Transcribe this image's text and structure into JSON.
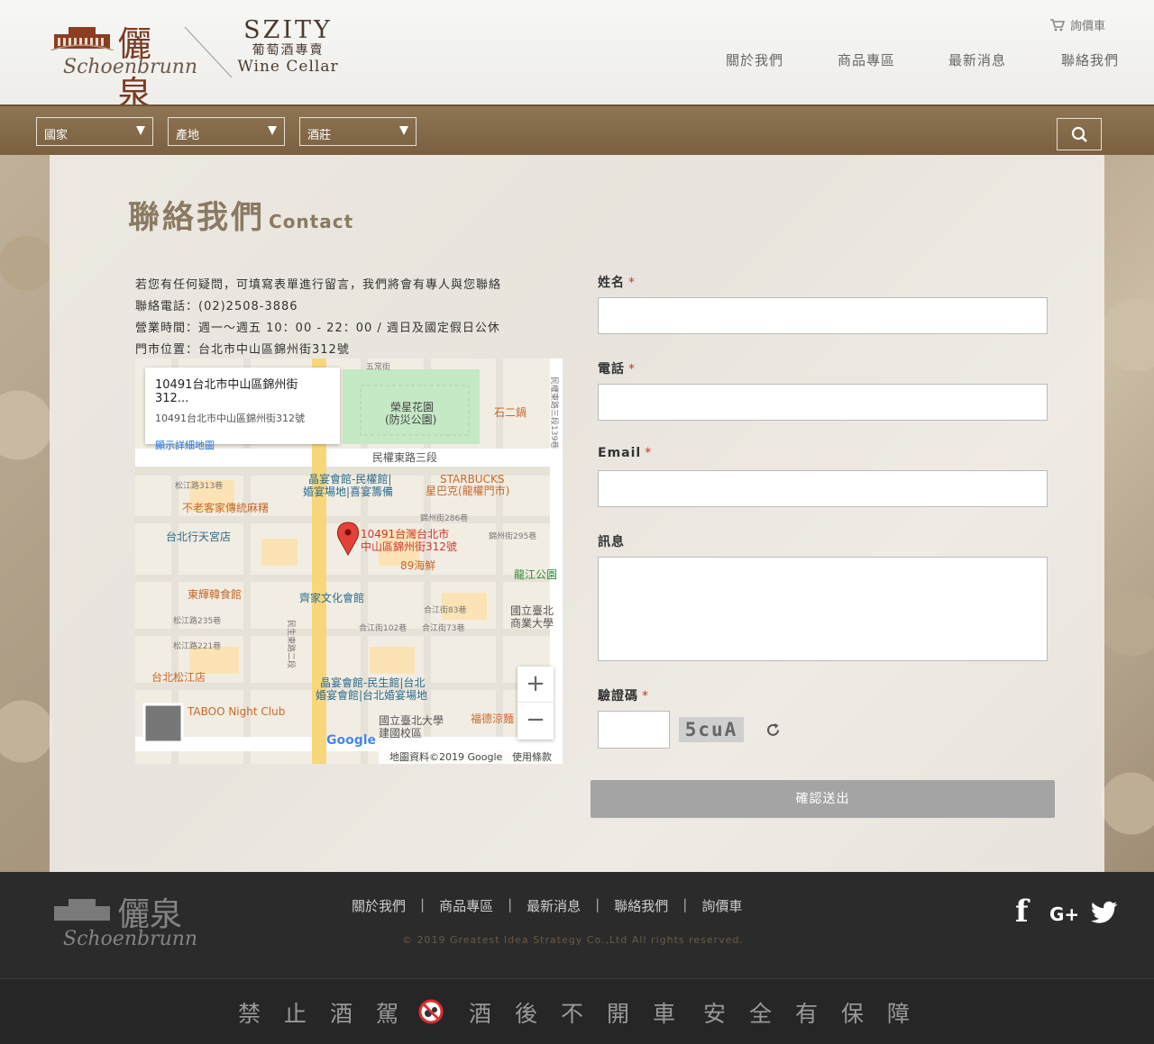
{
  "brand": {
    "logo_cn": "儷泉",
    "logo_en": "Schoenbrunn",
    "szity": "SZITY",
    "szity_cn": "葡萄酒專賣",
    "szity_en": "Wine Cellar"
  },
  "header": {
    "cart_label": "詢價車",
    "nav": [
      "關於我們",
      "商品專區",
      "最新消息",
      "聯絡我們"
    ]
  },
  "filters": {
    "country": "國家",
    "region": "產地",
    "winery": "酒莊"
  },
  "page": {
    "title": "聯絡我們",
    "title_en": "Contact"
  },
  "info": {
    "line1": "若您有任何疑問，可填寫表單進行留言，我們將會有專人與您聯絡",
    "line2": "聯絡電話：(02)2508-3886",
    "line3": "營業時間：週一～週五 10：00 - 22：00 / 週日及國定假日公休",
    "line4": "門市位置：台北市中山區錦州街312號"
  },
  "map": {
    "card_title": "10491台北市中山區錦州街312...",
    "card_sub": "10491台北市中山區錦州街312號",
    "card_link": "顯示詳細地圖",
    "pin_label1": "10491台灣台北市",
    "pin_label2": "中山區錦州街312號",
    "zoom_in": "+",
    "zoom_out": "−",
    "attribution": "地圖資料©2019 Google",
    "terms": "使用條款",
    "google": "Google",
    "places": [
      "榮星花園",
      "(防災公園)",
      "民權東路三段",
      "石二鍋",
      "晶宴會館-民權館|",
      "婚宴場地|喜宴籌備",
      "STARBUCKS",
      "星巴克(龍權門市)",
      "不老客家傳統麻糬",
      "台北行天宮店",
      "89海鮮",
      "東輝韓食館",
      "齊家文化會館",
      "龍江公園",
      "國立臺北",
      "商業大學",
      "建國校區",
      "TABOO Night Club",
      "晶宴會館-民生館|台北",
      "婚宴會館|台北婚宴場地",
      "國立臺北大學",
      "台北松江店",
      "福德涼麵",
      "松江路313巷",
      "錦州街286巷",
      "錦州街295巷",
      "合江街83巷",
      "合江街73巷",
      "合江街102巷",
      "松江路235巷",
      "松江路221巷",
      "五常街",
      "民生東路二段",
      "民權東路三段139巷"
    ]
  },
  "form": {
    "name_label": "姓名",
    "phone_label": "電話",
    "email_label": "Email",
    "message_label": "訊息",
    "captcha_label": "驗證碼",
    "captcha_code": "5cuA",
    "required": "*",
    "submit": "確認送出"
  },
  "footer": {
    "links": [
      "關於我們",
      "商品專區",
      "最新消息",
      "聯絡我們",
      "詢價車"
    ],
    "separator": "|",
    "copyright": "© 2019 Greatest Idea Strategy Co.,Ltd All rights reserved.",
    "social": [
      "facebook-icon",
      "google-plus-icon",
      "twitter-icon"
    ],
    "gplus": "G+",
    "fb": "f"
  },
  "warning": {
    "part1": "禁止酒駕",
    "part2": "酒後不開車",
    "part3": "安全有保障"
  },
  "colors": {
    "accent": "#8a7a62",
    "bar": "#7a6040",
    "footer": "#2b2b2b",
    "required": "#c0392b",
    "submit": "#a4a4a4"
  }
}
